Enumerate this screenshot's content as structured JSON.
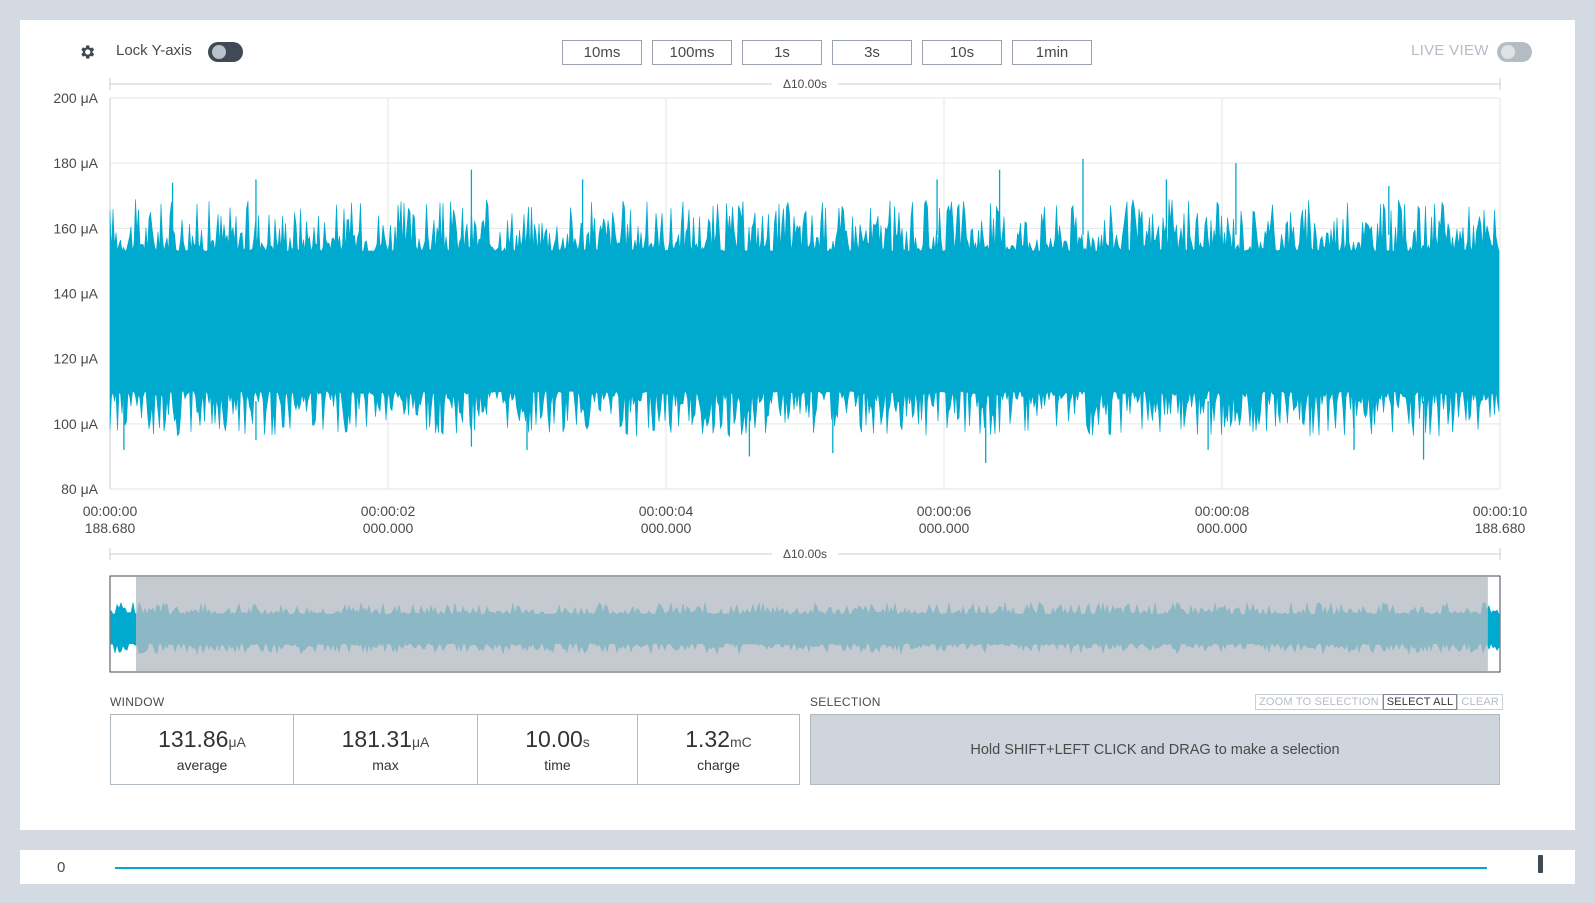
{
  "toolbar": {
    "lock_label": "Lock Y-axis",
    "live_label": "LIVE VIEW",
    "windows": [
      "10ms",
      "100ms",
      "1s",
      "3s",
      "10s",
      "1min"
    ]
  },
  "colors": {
    "accent": "#00a9ce",
    "minimap_selection": "#b3bbc3"
  },
  "chart_data": [
    {
      "type": "area",
      "title": "",
      "xlabel": "",
      "ylabel": "",
      "delta_label": "Δ10.00s",
      "ylim": [
        80,
        200
      ],
      "xlim": [
        0,
        10
      ],
      "y_ticks": [
        "200 μA",
        "180 μA",
        "160 μA",
        "140 μA",
        "120 μA",
        "100 μA",
        "80 μA"
      ],
      "x_tick_values": [
        0,
        2,
        4,
        6,
        8,
        10
      ],
      "x_ticks": [
        {
          "time": "00:00:00",
          "sub": "188.680"
        },
        {
          "time": "00:00:02",
          "sub": "000.000"
        },
        {
          "time": "00:00:04",
          "sub": "000.000"
        },
        {
          "time": "00:00:06",
          "sub": "000.000"
        },
        {
          "time": "00:00:08",
          "sub": "000.000"
        },
        {
          "time": "00:00:10",
          "sub": "188.680"
        }
      ],
      "grid": true,
      "series": [
        {
          "color": "#00a9ce",
          "band": {
            "typical_low": 107,
            "typical_high": 158,
            "overall_min": 87,
            "overall_max": 181.31
          },
          "spikes_high": [
            [
              0.45,
              174
            ],
            [
              1.05,
              175
            ],
            [
              2.6,
              178
            ],
            [
              3.4,
              175
            ],
            [
              5.95,
              175
            ],
            [
              6.4,
              178
            ],
            [
              7.0,
              181.31
            ],
            [
              7.6,
              175
            ],
            [
              8.1,
              180
            ],
            [
              9.2,
              173
            ]
          ],
          "spikes_low": [
            [
              0.1,
              92
            ],
            [
              1.05,
              95
            ],
            [
              2.6,
              93
            ],
            [
              3.0,
              92
            ],
            [
              4.6,
              90
            ],
            [
              5.2,
              91
            ],
            [
              6.3,
              88
            ],
            [
              7.9,
              92
            ],
            [
              8.95,
              92
            ],
            [
              9.45,
              89
            ]
          ]
        }
      ]
    },
    {
      "type": "area",
      "title": "",
      "delta_label": "Δ10.00s",
      "selection_window": [
        0.18,
        9.92
      ],
      "series": [
        {
          "color": "#00a9ce"
        }
      ]
    }
  ],
  "window": {
    "label": "WINDOW",
    "stats": [
      {
        "value": "131.86",
        "unit": "μA",
        "label": "average"
      },
      {
        "value": "181.31",
        "unit": "μA",
        "label": "max"
      },
      {
        "value": "10.00",
        "unit": "s",
        "label": "time"
      },
      {
        "value": "1.32",
        "unit": "mC",
        "label": "charge"
      }
    ]
  },
  "selection": {
    "label": "SELECTION",
    "hint": "Hold SHIFT+LEFT CLICK and DRAG to make a selection",
    "buttons": [
      "ZOOM TO SELECTION",
      "SELECT ALL",
      "CLEAR"
    ]
  },
  "bottom": {
    "zero_label": "0"
  }
}
